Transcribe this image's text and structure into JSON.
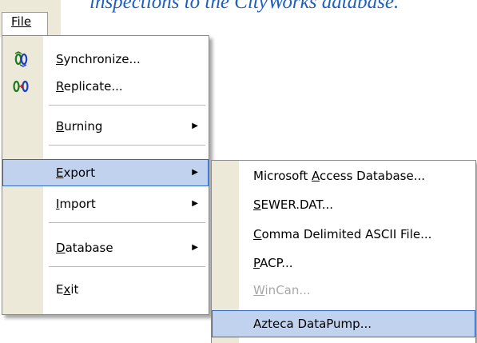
{
  "caption": "inspections to the CityWorks database.",
  "menubar": {
    "file_label": "File"
  },
  "file_menu": {
    "items": [
      {
        "label": "Synchronize...",
        "icon": "synchronize-icon",
        "underline": "S"
      },
      {
        "label": "Replicate...",
        "icon": "replicate-icon",
        "underline": "R"
      },
      {
        "label": "Burning",
        "submenu": true,
        "underline": "B"
      },
      {
        "label": "Export",
        "submenu": true,
        "selected": true,
        "underline": "E"
      },
      {
        "label": "Import",
        "submenu": true,
        "underline": "I"
      },
      {
        "label": "Database",
        "submenu": true,
        "underline": "D"
      },
      {
        "label": "Exit",
        "underline": "x"
      }
    ]
  },
  "export_menu": {
    "items": [
      {
        "label": "Microsoft Access Database...",
        "underline": "A"
      },
      {
        "label": "SEWER.DAT...",
        "underline": "S"
      },
      {
        "label": "Comma Delimited ASCII File...",
        "underline": "C"
      },
      {
        "label": "PACP...",
        "underline": "P"
      },
      {
        "label": "WinCan...",
        "disabled": true,
        "underline": "W"
      },
      {
        "label": "Azteca DataPump...",
        "selected": true
      }
    ]
  },
  "colors": {
    "caption": "#1f5fbf",
    "selection_fill": "#c1d2ee",
    "selection_border": "#316ac5",
    "icon_strip": "#ece9d8"
  }
}
